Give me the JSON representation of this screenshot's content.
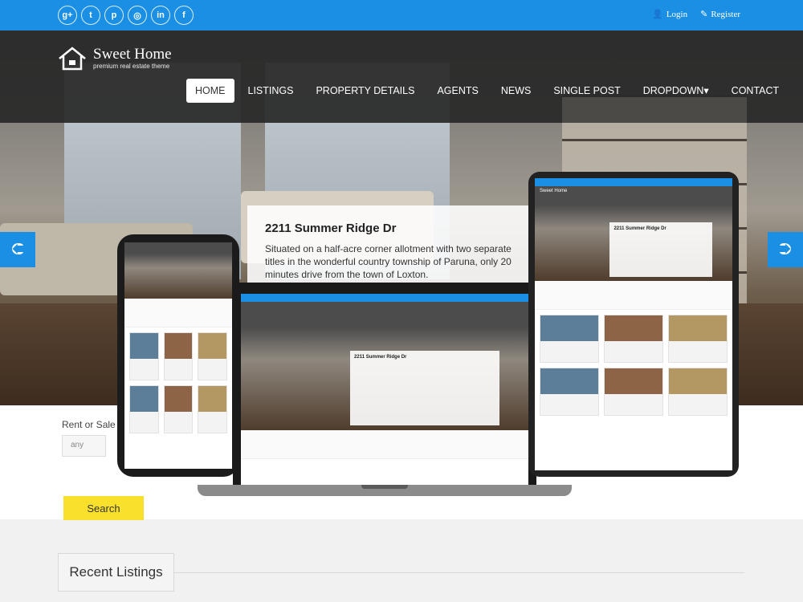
{
  "topbar": {
    "social": [
      {
        "icon": "google-plus-icon",
        "glyph": "g+"
      },
      {
        "icon": "twitter-icon",
        "glyph": "t"
      },
      {
        "icon": "pinterest-icon",
        "glyph": "p"
      },
      {
        "icon": "dribbble-icon",
        "glyph": "◎"
      },
      {
        "icon": "linkedin-icon",
        "glyph": "in"
      },
      {
        "icon": "facebook-icon",
        "glyph": "f"
      }
    ],
    "login_label": "Login",
    "register_label": "Register"
  },
  "brand": {
    "title": "Sweet Home",
    "subtitle": "premium real estate theme"
  },
  "nav": {
    "items": [
      "HOME",
      "LISTINGS",
      "PROPERTY DETAILS",
      "AGENTS",
      "NEWS",
      "SINGLE POST",
      "DROPDOWN▾",
      "CONTACT"
    ],
    "active": "HOME"
  },
  "slider": {
    "title": "2211 Summer Ridge Dr",
    "text": "Situated on a half-acre corner allotment with two separate titles in the wonderful country township of Paruna, only 20 minutes drive from the town of Loxton."
  },
  "search": {
    "rent_or_sale_label": "Rent or Sale",
    "rent_or_sale_value": "any",
    "button_label": "Search"
  },
  "recent": {
    "heading": "Recent Listings"
  },
  "devices": {
    "laptop_title": "2211 Summer Ridge Dr",
    "tablet_title": "Sweet Home",
    "tablet_listing": "2211 Summer Ridge Dr"
  },
  "colors": {
    "primary": "#1a8fe3",
    "accent": "#f9e12b"
  }
}
